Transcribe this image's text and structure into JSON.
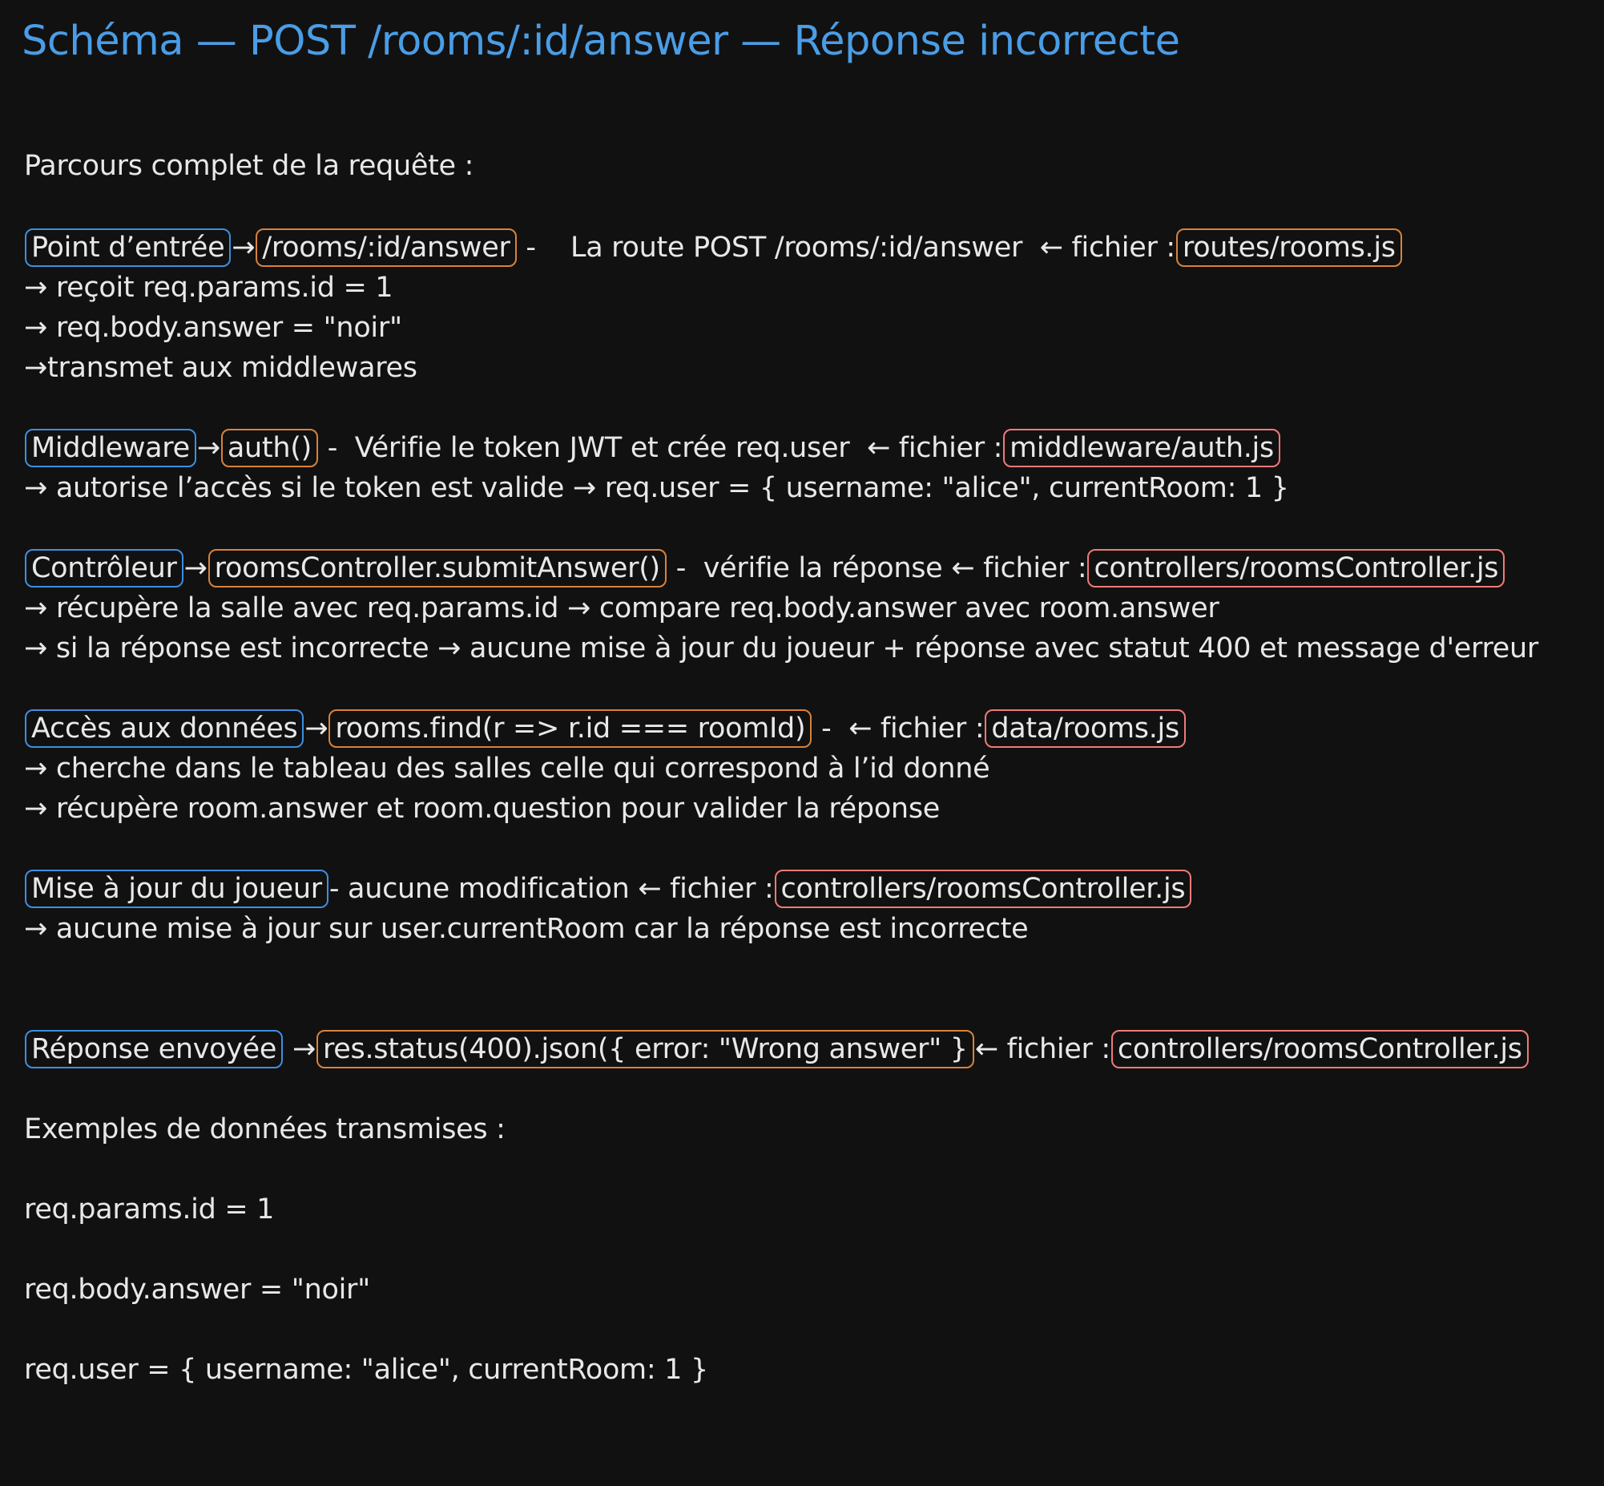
{
  "title": "Schéma — POST /rooms/:id/answer — Réponse incorrecte",
  "intro": "Parcours complet de la requête :",
  "colors": {
    "title": "#4a9de6",
    "step_border": "#3d8fe0",
    "code_border": "#d9823a",
    "file_border": "#f07a78",
    "background": "#111111",
    "text": "#e8e8e8"
  },
  "sections": {
    "entry": {
      "label": "Point d’entrée",
      "arrow": "→",
      "code": "/rooms/:id/answer",
      "desc": " -    La route POST /rooms/:id/answer  ← fichier :",
      "file": "routes/rooms.js",
      "details": [
        "→ reçoit req.params.id = 1",
        "→ req.body.answer = \"noir\"",
        "→transmet aux middlewares"
      ]
    },
    "middleware": {
      "label": "Middleware",
      "arrow": "→",
      "code": "auth()",
      "desc": " -  Vérifie le token JWT et crée req.user  ← fichier :",
      "file": "middleware/auth.js",
      "details": [
        "→ autorise l’accès si le token est valide → req.user = { username: \"alice\", currentRoom: 1 }"
      ]
    },
    "controller": {
      "label": "Contrôleur",
      "arrow": "→",
      "code": "roomsController.submitAnswer()",
      "desc": " -  vérifie la réponse ← fichier :",
      "file": "controllers/roomsController.js",
      "details": [
        "→ récupère la salle avec req.params.id → compare req.body.answer avec room.answer",
        "→ si la réponse est incorrecte → aucune mise à jour du joueur + réponse avec statut 400 et message d'erreur"
      ]
    },
    "data_access": {
      "label": "Accès aux données",
      "arrow": "→",
      "code": "rooms.find(r => r.id === roomId)",
      "desc": " -  ← fichier :",
      "file": "data/rooms.js",
      "details": [
        "→ cherche dans le tableau des salles celle qui correspond à l’id donné",
        "→ récupère room.answer et room.question pour valider la réponse"
      ]
    },
    "player_update": {
      "label": "Mise à jour du joueur",
      "desc": "- aucune modification ← fichier :",
      "file": "controllers/roomsController.js",
      "details": [
        "→ aucune mise à jour sur user.currentRoom car la réponse est incorrecte"
      ]
    },
    "response": {
      "label": "Réponse envoyée",
      "arrow": "→",
      "code": "res.status(400).json({ error: \"Wrong answer\" }",
      "desc": "← fichier :",
      "file": "controllers/roomsController.js"
    }
  },
  "examples": {
    "heading": "Exemples de données transmises :",
    "items": [
      "req.params.id = 1",
      "req.body.answer = \"noir\"",
      "req.user = { username: \"alice\", currentRoom: 1 }"
    ]
  }
}
